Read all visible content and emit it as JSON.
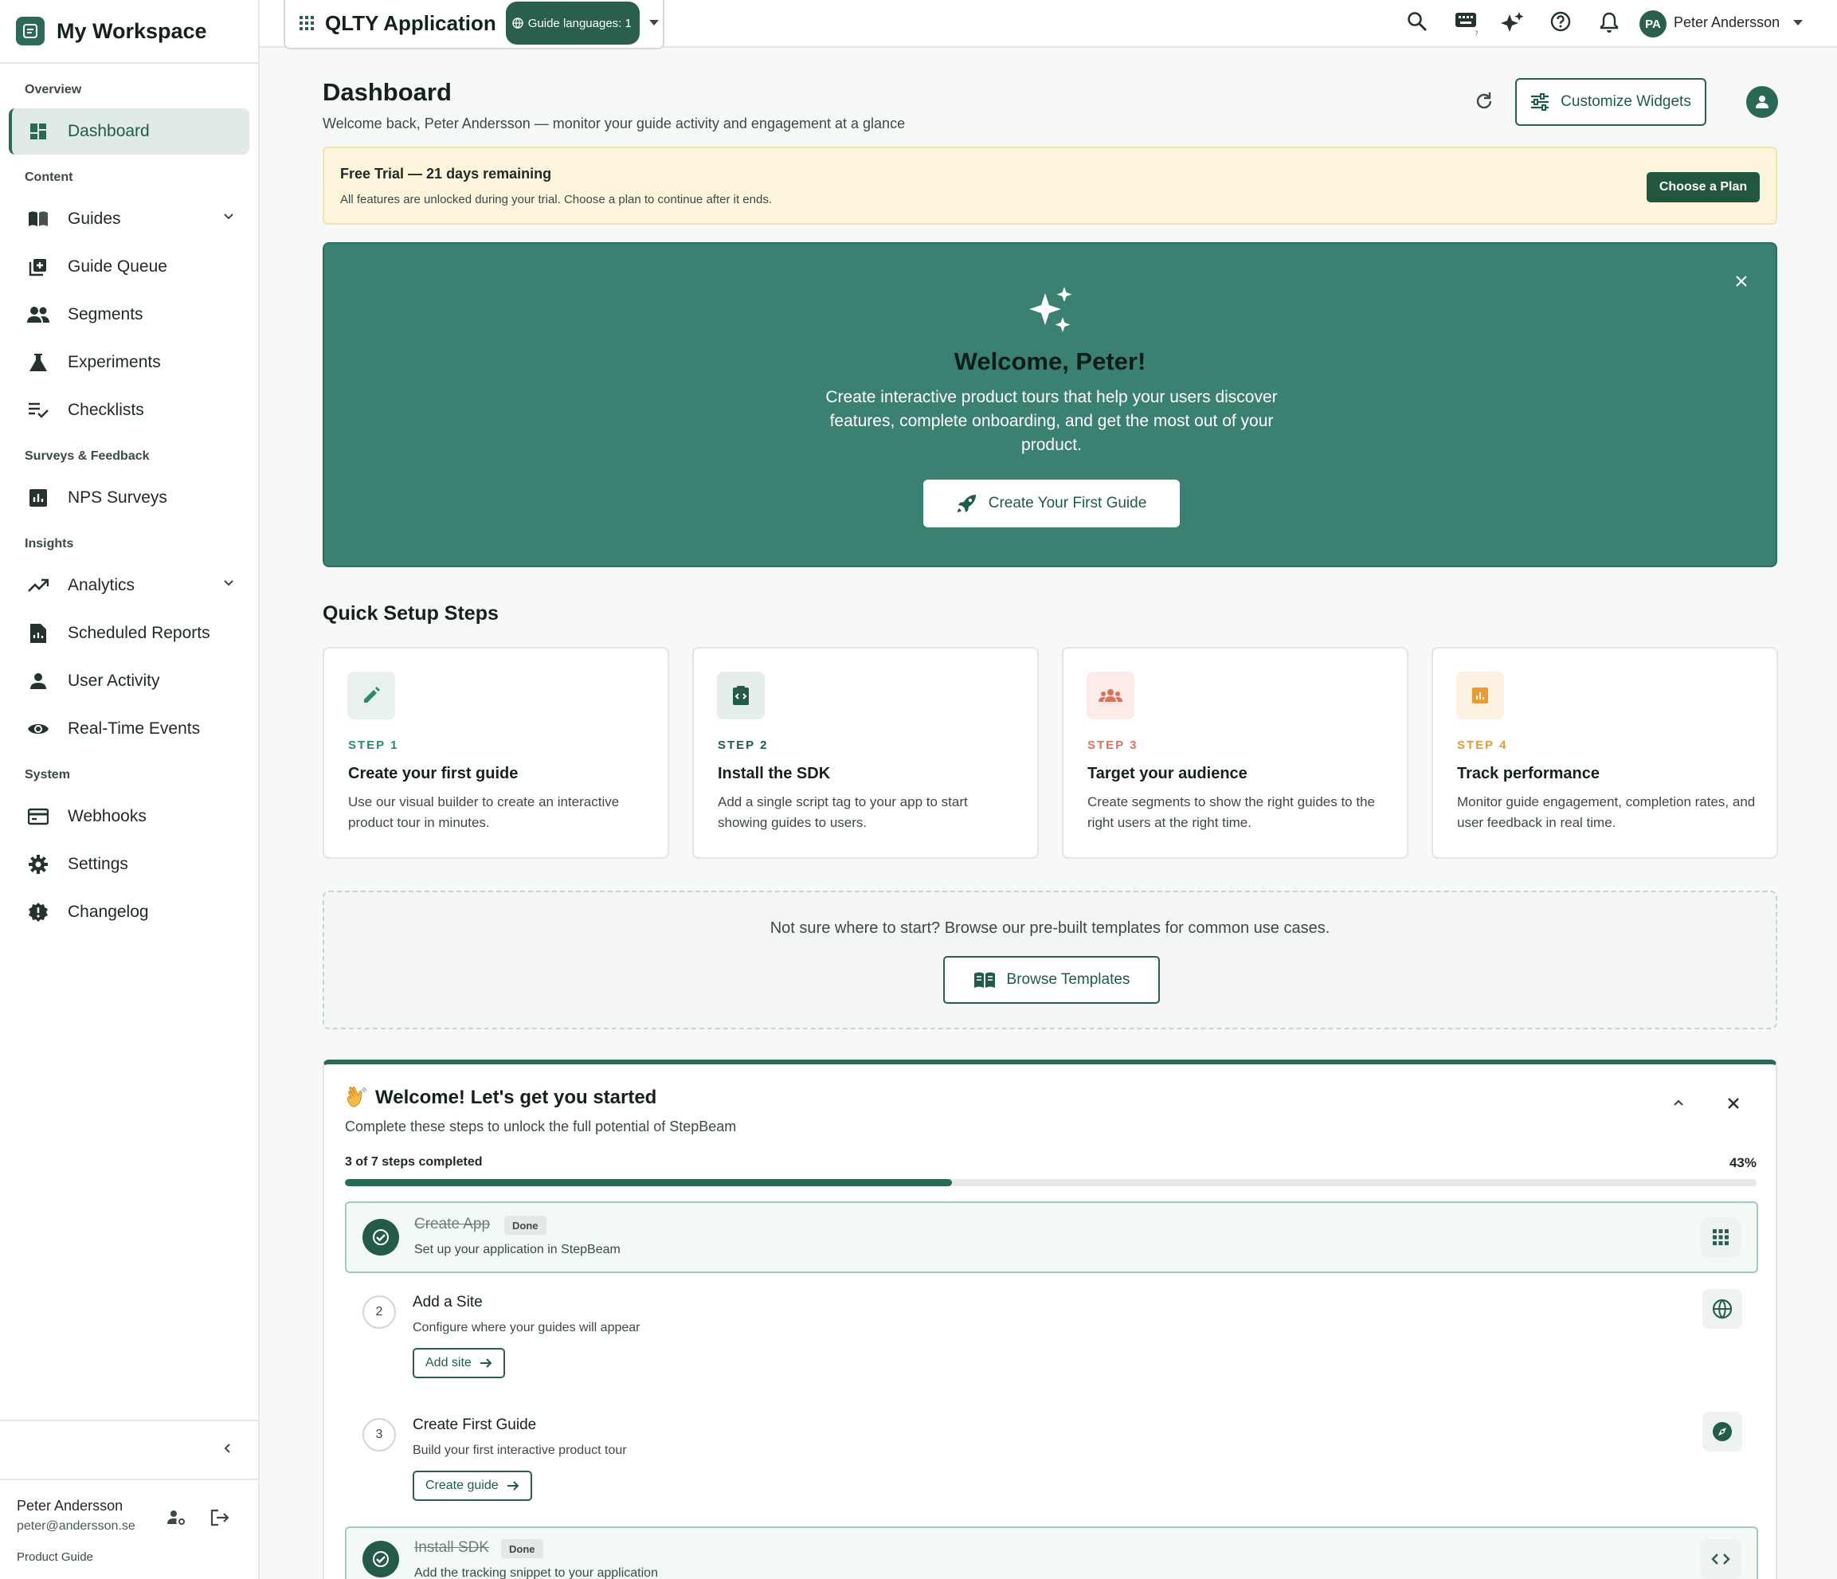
{
  "sidebar": {
    "workspace_title": "My Workspace",
    "sections": {
      "overview": "Overview",
      "content": "Content",
      "surveys": "Surveys & Feedback",
      "insights": "Insights",
      "system": "System"
    },
    "items": {
      "dashboard": "Dashboard",
      "guides": "Guides",
      "guide_queue": "Guide Queue",
      "segments": "Segments",
      "experiments": "Experiments",
      "checklists": "Checklists",
      "nps_surveys": "NPS Surveys",
      "analytics": "Analytics",
      "scheduled_reports": "Scheduled Reports",
      "user_activity": "User Activity",
      "realtime_events": "Real-Time Events",
      "webhooks": "Webhooks",
      "settings": "Settings",
      "changelog": "Changelog"
    },
    "user": {
      "name": "Peter Andersson",
      "email": "peter@andersson.se"
    },
    "product_guide": "Product Guide"
  },
  "topbar": {
    "app_name": "QLTY Application",
    "guide_languages": "Guide languages: 1",
    "avatar_initials": "PA",
    "user_name": "Peter Andersson",
    "icons": [
      "search-icon",
      "keyboard-icon",
      "sparkle-icon",
      "help-icon",
      "bell-icon"
    ]
  },
  "header": {
    "title": "Dashboard",
    "subtitle": "Welcome back, Peter Andersson — monitor your guide activity and engagement at a glance",
    "customize_label": "Customize Widgets"
  },
  "trial": {
    "title": "Free Trial — 21 days remaining",
    "subtitle": "All features are unlocked during your trial. Choose a plan to continue after it ends.",
    "cta": "Choose a Plan"
  },
  "hero": {
    "title": "Welcome, Peter!",
    "body": "Create interactive product tours that help your users discover features, complete onboarding, and get the most out of your product.",
    "cta": "Create Your First Guide"
  },
  "quick_setup": {
    "title": "Quick Setup Steps",
    "steps": [
      {
        "label": "STEP 1",
        "title": "Create your first guide",
        "desc": "Use our visual builder to create an interactive product tour in minutes.",
        "icon": "pencil-icon",
        "color": "#2a8a6a"
      },
      {
        "label": "STEP 2",
        "title": "Install the SDK",
        "desc": "Add a single script tag to your app to start showing guides to users.",
        "icon": "code-clipboard-icon",
        "color": "#235b46"
      },
      {
        "label": "STEP 3",
        "title": "Target your audience",
        "desc": "Create segments to show the right guides to the right users at the right time.",
        "icon": "people-icon",
        "color": "#e0705e"
      },
      {
        "label": "STEP 4",
        "title": "Track performance",
        "desc": "Monitor guide engagement, completion rates, and user feedback in real time.",
        "icon": "chart-icon",
        "color": "#e89a35"
      }
    ]
  },
  "templates": {
    "text": "Not sure where to start? Browse our pre-built templates for common use cases.",
    "cta": "Browse Templates"
  },
  "onboarding": {
    "title": "Welcome! Let's get you started",
    "subtitle": "Complete these steps to unlock the full potential of StepBeam",
    "progress_label": "3 of 7 steps completed",
    "progress_pct": "43%",
    "progress_fraction": 0.43,
    "done_label": "Done",
    "tasks": [
      {
        "num": "1",
        "title": "Create App",
        "desc": "Set up your application in StepBeam",
        "done": true,
        "icon": "grid-icon"
      },
      {
        "num": "2",
        "title": "Add a Site",
        "desc": "Configure where your guides will appear",
        "done": false,
        "cta": "Add site",
        "icon": "globe-icon"
      },
      {
        "num": "3",
        "title": "Create First Guide",
        "desc": "Build your first interactive product tour",
        "done": false,
        "cta": "Create guide",
        "icon": "compass-icon"
      },
      {
        "num": "4",
        "title": "Install SDK",
        "desc": "Add the tracking snippet to your application",
        "done": true,
        "icon": "code-icon"
      }
    ]
  }
}
